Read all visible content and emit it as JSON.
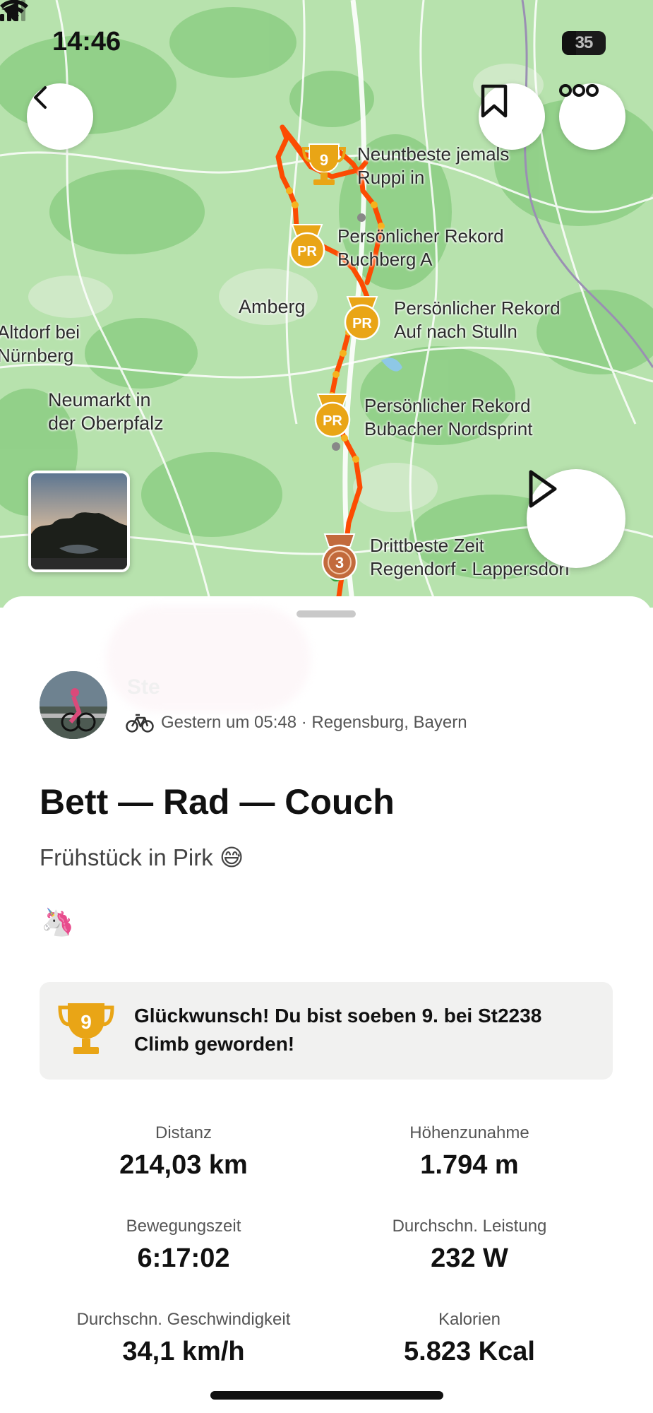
{
  "status_bar": {
    "time": "14:46",
    "battery": "35"
  },
  "map": {
    "place_labels": {
      "amberg": "Amberg",
      "altdorf_line1": "Altdorf bei",
      "altdorf_line2": "Nürnberg",
      "neumarkt_line1": "Neumarkt in",
      "neumarkt_line2": "der Oberpfalz"
    },
    "segments": [
      {
        "badge": "9",
        "line1": "Neuntbeste jemals",
        "line2": "Ruppi in"
      },
      {
        "badge": "PR",
        "line1": "Persönlicher Rekord",
        "line2": "Buchberg A"
      },
      {
        "badge": "PR",
        "line1": "Persönlicher Rekord",
        "line2": "Auf nach Stulln"
      },
      {
        "badge": "PR",
        "line1": "Persönlicher Rekord",
        "line2": "Bubacher Nordsprint"
      },
      {
        "badge": "3",
        "line1": "Drittbeste Zeit",
        "line2": "Regendorf - Lappersdorf"
      }
    ]
  },
  "activity": {
    "athlete_name": "Ste",
    "meta": "Gestern um 05:48 · Regensburg, Bayern",
    "title": "Bett — Rad — Couch",
    "description": "Frühstück in Pirk 😅",
    "emoji": "🦄",
    "congrats_badge": "9",
    "congrats_text": "Glückwunsch! Du bist soeben 9. bei St2238 Climb geworden!"
  },
  "stats": [
    {
      "label": "Distanz",
      "value": "214,03 km"
    },
    {
      "label": "Höhenzunahme",
      "value": "1.794 m"
    },
    {
      "label": "Bewegungszeit",
      "value": "6:17:02"
    },
    {
      "label": "Durchschn. Leistung",
      "value": "232 W"
    },
    {
      "label": "Durchschn. Geschwindigkeit",
      "value": "34,1 km/h"
    },
    {
      "label": "Kalorien",
      "value": "5.823 Kcal"
    }
  ],
  "colors": {
    "route": "#fc4c02",
    "gold": "#e9a516",
    "bronze": "#c26a3c",
    "map_green": "#a9dca0"
  }
}
